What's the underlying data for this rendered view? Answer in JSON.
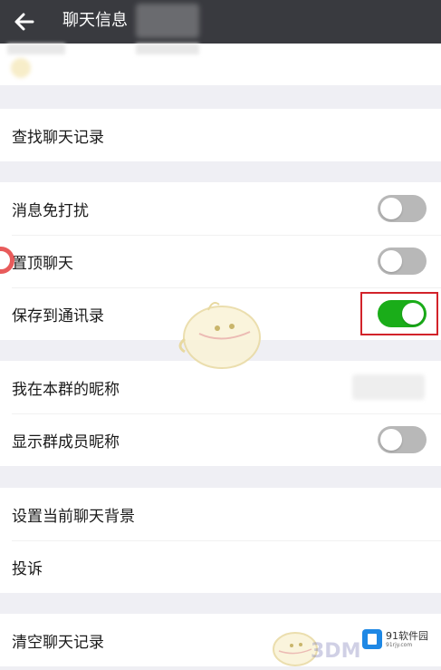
{
  "header": {
    "title": "聊天信息"
  },
  "groups": {
    "search": {
      "label": "查找聊天记录"
    },
    "toggles": [
      {
        "label": "消息免打扰",
        "on": false
      },
      {
        "label": "置顶聊天",
        "on": false
      },
      {
        "label": "保存到通讯录",
        "on": true,
        "highlighted": true
      }
    ],
    "group_settings": {
      "nickname_label": "我在本群的昵称",
      "show_names": {
        "label": "显示群成员昵称",
        "on": false
      }
    },
    "misc": [
      {
        "label": "设置当前聊天背景"
      },
      {
        "label": "投诉"
      }
    ],
    "clear": {
      "label": "清空聊天记录"
    }
  },
  "colors": {
    "header_bg": "#393a3f",
    "toggle_on": "#1aad19",
    "toggle_off": "#b8b8b8",
    "highlight_border": "#d2232a"
  },
  "watermark": {
    "brand": "91软件园",
    "sub": "91rjy.com",
    "mark": "3DM"
  }
}
